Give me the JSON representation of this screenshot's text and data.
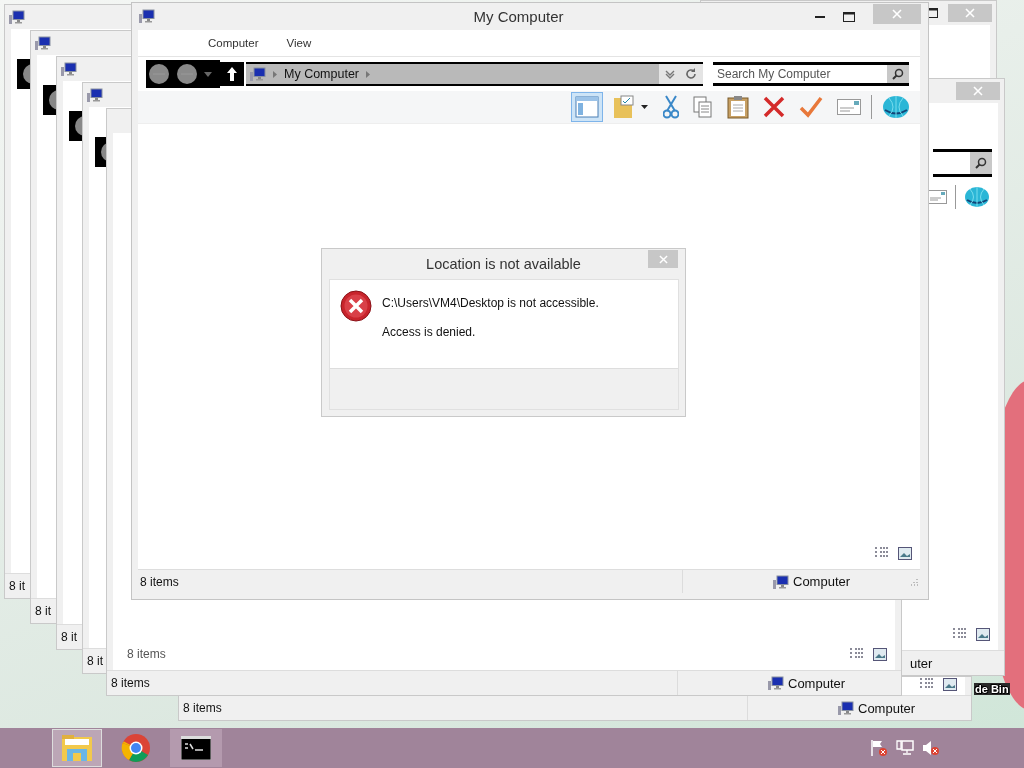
{
  "desktop": {
    "recycle_bin_label": "de Bin"
  },
  "windows": [
    {
      "kind": "cascade",
      "status": "8 it"
    },
    {
      "kind": "cascade",
      "status": "8 it"
    },
    {
      "kind": "cascade",
      "status": "8 it"
    },
    {
      "kind": "cascade",
      "status": "8 it"
    },
    {
      "kind": "back",
      "status": "8 items",
      "location": "Computer"
    },
    {
      "kind": "edge"
    },
    {
      "kind": "side",
      "location": "uter"
    },
    {
      "kind": "front",
      "status": "8 items",
      "body_note": "8 items",
      "location": "Computer"
    }
  ],
  "main_window": {
    "title": "My Computer",
    "menu": [
      {
        "label": "Computer"
      },
      {
        "label": "View"
      }
    ],
    "address": "My Computer",
    "search": {
      "placeholder": "Search My Computer"
    },
    "tools": [
      {
        "kind": "layout",
        "selected": true
      },
      {
        "kind": "folder",
        "selected": false
      },
      {
        "kind": "cut",
        "selected": false
      },
      {
        "kind": "copy",
        "selected": false
      },
      {
        "kind": "paste",
        "selected": false
      },
      {
        "kind": "delete",
        "selected": false
      },
      {
        "kind": "check",
        "selected": false
      },
      {
        "kind": "card",
        "selected": false
      },
      {
        "kind": "globe",
        "selected": false
      }
    ],
    "status": "8 items",
    "location": "Computer"
  },
  "dialog": {
    "title": "Location is not available",
    "message": "C:\\Users\\VM4\\Desktop is not accessible.",
    "detail": "Access is denied."
  },
  "taskbar": {
    "apps": [
      {
        "kind": "explorer",
        "running": true,
        "active": true
      },
      {
        "kind": "chrome",
        "running": false,
        "active": false
      },
      {
        "kind": "console",
        "running": true,
        "active": false
      }
    ]
  }
}
